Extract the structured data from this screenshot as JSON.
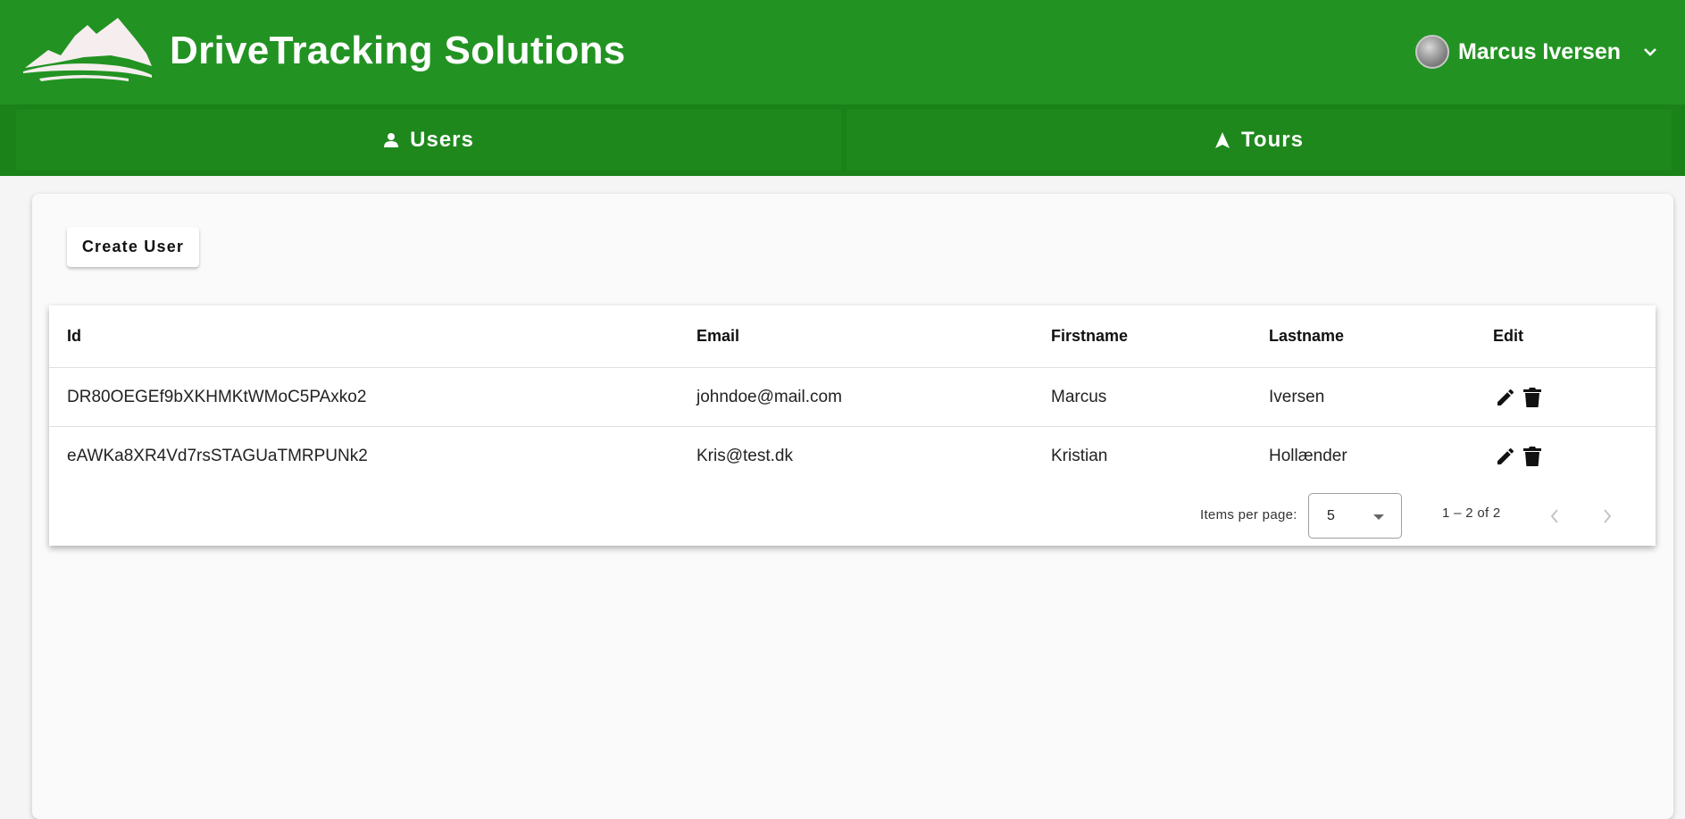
{
  "header": {
    "app_title": "DriveTracking Solutions",
    "user_name": "Marcus Iversen",
    "colors": {
      "primary": "#229322",
      "nav": "#1a8219"
    }
  },
  "nav": {
    "tabs": [
      {
        "label": "Users",
        "icon": "person-icon"
      },
      {
        "label": "Tours",
        "icon": "navigation-arrow-icon"
      }
    ]
  },
  "main": {
    "create_user_label": "Create User",
    "table": {
      "columns": [
        "Id",
        "Email",
        "Firstname",
        "Lastname",
        "Edit"
      ],
      "rows": [
        {
          "id": "DR80OEGEf9bXKHMKtWMoC5PAxko2",
          "email": "johndoe@mail.com",
          "firstname": "Marcus",
          "lastname": "Iversen"
        },
        {
          "id": "eAWKa8XR4Vd7rsSTAGUaTMRPUNk2",
          "email": "Kris@test.dk",
          "firstname": "Kristian",
          "lastname": "Hollænder"
        }
      ]
    },
    "paginator": {
      "items_per_page_label": "Items per page:",
      "items_per_page_value": "5",
      "range_label": "1 – 2 of 2"
    }
  }
}
